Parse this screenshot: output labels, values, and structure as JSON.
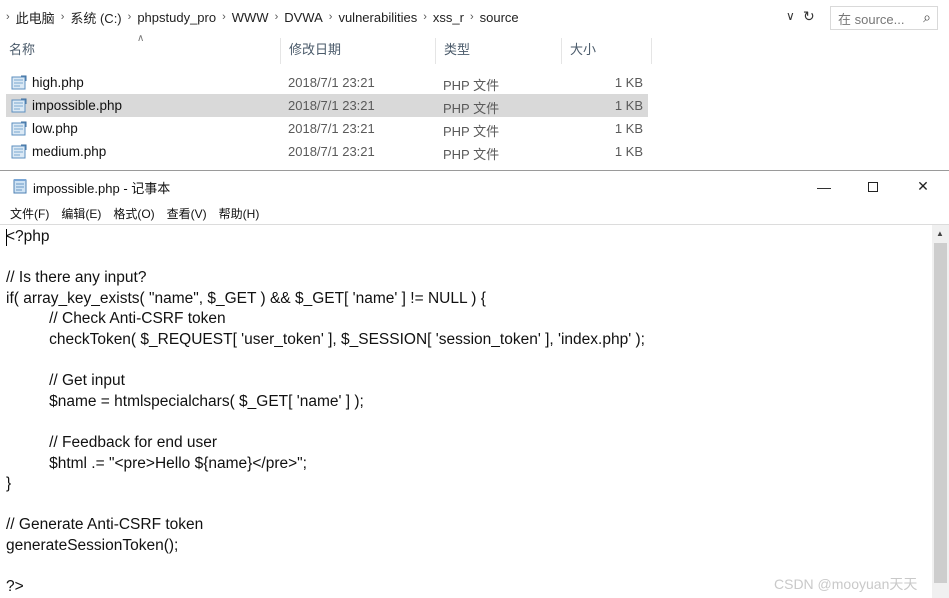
{
  "explorer": {
    "breadcrumb": [
      "此电脑",
      "系统 (C:)",
      "phpstudy_pro",
      "WWW",
      "DVWA",
      "vulnerabilities",
      "xss_r",
      "source"
    ],
    "search_placeholder": "在 source...",
    "columns": {
      "name": "名称",
      "date": "修改日期",
      "type": "类型",
      "size": "大小"
    },
    "files": [
      {
        "name": "high.php",
        "date": "2018/7/1 23:21",
        "type": "PHP 文件",
        "size": "1 KB",
        "selected": false
      },
      {
        "name": "impossible.php",
        "date": "2018/7/1 23:21",
        "type": "PHP 文件",
        "size": "1 KB",
        "selected": true
      },
      {
        "name": "low.php",
        "date": "2018/7/1 23:21",
        "type": "PHP 文件",
        "size": "1 KB",
        "selected": false
      },
      {
        "name": "medium.php",
        "date": "2018/7/1 23:21",
        "type": "PHP 文件",
        "size": "1 KB",
        "selected": false
      }
    ]
  },
  "notepad": {
    "title": "impossible.php - 记事本",
    "menu": [
      "文件(F)",
      "编辑(E)",
      "格式(O)",
      "查看(V)",
      "帮助(H)"
    ],
    "code_lines": [
      "<?php",
      "",
      "// Is there any input?",
      "if( array_key_exists( \"name\", $_GET ) && $_GET[ 'name' ] != NULL ) {",
      "\t// Check Anti-CSRF token",
      "\tcheckToken( $_REQUEST[ 'user_token' ], $_SESSION[ 'session_token' ], 'index.php' );",
      "",
      "\t// Get input",
      "\t$name = htmlspecialchars( $_GET[ 'name' ] );",
      "",
      "\t// Feedback for end user",
      "\t$html .= \"<pre>Hello ${name}</pre>\";",
      "}",
      "",
      "// Generate Anti-CSRF token",
      "generateSessionToken();",
      "",
      "?>"
    ]
  },
  "watermark": "CSDN @mooyuan天天"
}
